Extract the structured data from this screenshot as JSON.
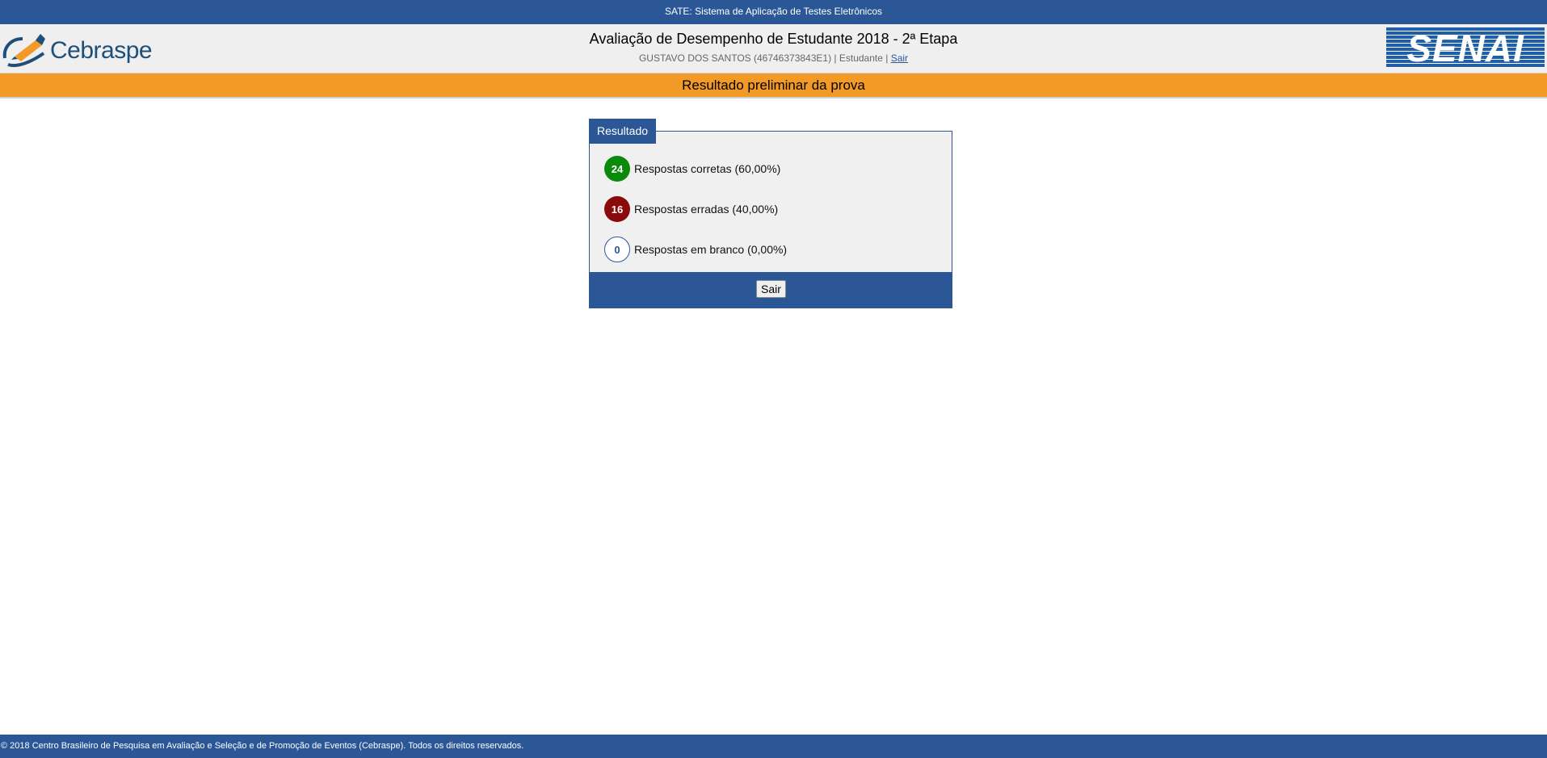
{
  "topbar": {
    "text": "SATE: Sistema de Aplicação de Testes Eletrônicos"
  },
  "header": {
    "brand_left": "Cebraspe",
    "title": "Avaliação de Desempenho de Estudante 2018 - 2ª Etapa",
    "user_info": "GUSTAVO DOS SANTOS (46746373843E1) | Estudante | ",
    "logout_link": "Sair",
    "brand_right": "SENAI"
  },
  "banner": {
    "text": "Resultado preliminar da prova"
  },
  "result_panel": {
    "tab_label": "Resultado",
    "rows": [
      {
        "count": "24",
        "label": "Respostas corretas (60,00%)",
        "kind": "correct",
        "color": "#0a8a0a"
      },
      {
        "count": "16",
        "label": "Respostas erradas (40,00%)",
        "kind": "wrong",
        "color": "#8b0a0a"
      },
      {
        "count": "0",
        "label": "Respostas em branco (0,00%)",
        "kind": "blank",
        "color": "#2b5797"
      }
    ],
    "button_label": "Sair"
  },
  "footer": {
    "text": "© 2018 Centro Brasileiro de Pesquisa em Avaliação e Seleção e de Promoção de Eventos (Cebraspe). Todos os direitos reservados."
  },
  "colors": {
    "primary_blue": "#2b5797",
    "accent_orange": "#f39a26",
    "header_bg": "#efefef"
  }
}
